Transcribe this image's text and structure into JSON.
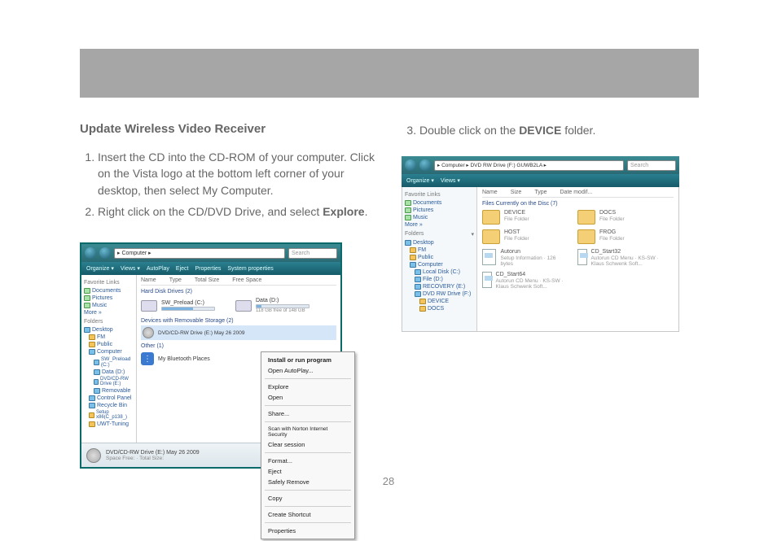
{
  "section_title": "Update Wireless Video Receiver",
  "steps": {
    "s1": "Insert the CD into the CD-ROM of your computer.  Click on the Vista logo at the bottom left corner of your desktop, then select My Computer.",
    "s2_pre": "Right click on the CD/DVD Drive, and select ",
    "s2_bold": "Explore",
    "s2_post": ".",
    "s3_pre": "Double click on the ",
    "s3_bold": "DEVICE",
    "s3_post": " folder."
  },
  "page_number": "28",
  "shot1": {
    "address": " ▸ Computer ▸",
    "search": "Search",
    "toolbar": [
      "Organize ▾",
      "Views ▾",
      "AutoPlay",
      "Eject",
      "Properties",
      "System properties"
    ],
    "side_header1": "Favorite Links",
    "side_links": [
      "Documents",
      "Pictures",
      "Music",
      "More »"
    ],
    "side_header2": "Folders",
    "side_tree": [
      "Desktop",
      "FM",
      "Public",
      "Computer",
      "SW_Preload (C:)",
      "Data (D:)",
      "DVD/CD-RW Drive (E:)",
      "Removable",
      "Control Panel",
      "Recycle Bin",
      "Setup x86(C_p138_)",
      "UWT-Tuning"
    ],
    "columns": [
      "Name",
      "Type",
      "Total Size",
      "Free Space"
    ],
    "group1": "Hard Disk Drives (2)",
    "drives": [
      "SW_Preload (C:)",
      "Data (D:)"
    ],
    "drive_bar_text": "118 GB free of 148 GB",
    "group2": "Devices with Removable Storage (2)",
    "dvd": "DVD/CD-RW Drive (E:) May 26 2009",
    "other": "Other (1)",
    "bt": "My Bluetooth Places",
    "context": {
      "head": "Install or run program",
      "items": [
        "Open AutoPlay...",
        "Explore",
        "Open",
        "Share...",
        "Scan with Norton Internet Security",
        "Clear session",
        "Format...",
        "Eject",
        "Safely Remove",
        "Copy",
        "Create Shortcut",
        "Properties"
      ]
    },
    "status_title": "DVD/CD-RW Drive (E:) May 26 2009",
    "status_sub": "Space Free:  ·  Total Size:"
  },
  "shot2": {
    "address": " ▸ Computer ▸ DVD RW Drive (F:) GUWB2LA ▸",
    "search": "Search",
    "toolbar": [
      "Organize ▾",
      "Views ▾"
    ],
    "side_header1": "Favorite Links",
    "side_links": [
      "Documents",
      "Pictures",
      "Music",
      "More »"
    ],
    "side_header2": "Folders",
    "side_tree": [
      "Desktop",
      "FM",
      "Public",
      "Computer",
      "Local Disk (C:)",
      "File (D:)",
      "RECOVERY (E:)",
      "DVD RW Drive (F:)",
      "DEVICE",
      "DOCS"
    ],
    "columns": [
      "Name",
      "Size",
      "Type",
      "Date modif..."
    ],
    "group": "Files Currently on the Disc (7)",
    "items": [
      {
        "name": "DEVICE",
        "sub": "File Folder",
        "type": "folder"
      },
      {
        "name": "DOCS",
        "sub": "File Folder",
        "type": "folder"
      },
      {
        "name": "HOST",
        "sub": "File Folder",
        "type": "folder"
      },
      {
        "name": "FROG",
        "sub": "File Folder",
        "type": "folder"
      },
      {
        "name": "Autorun",
        "sub": "Setup Information · 126 bytes",
        "type": "file"
      },
      {
        "name": "CD_Start32",
        "sub": "Autorun CD Menu · KS-SW · Klaus Schwenk Soft...",
        "type": "file"
      },
      {
        "name": "CD_Start64",
        "sub": "Autorun CD Menu · KS-SW · Klaus Schwenk Soft...",
        "type": "file"
      }
    ]
  }
}
